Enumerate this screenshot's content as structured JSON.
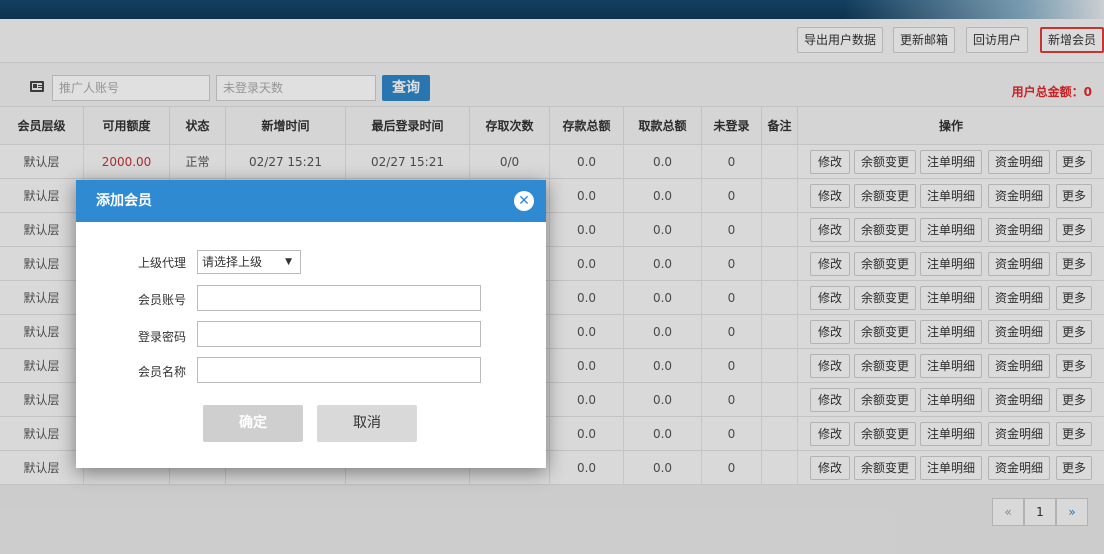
{
  "toolbar": {
    "export_label": "导出用户数据",
    "update_email_label": "更新邮箱",
    "revisit_label": "回访用户",
    "add_member_label": "新增会员"
  },
  "filter": {
    "promoter_placeholder": "推广人账号",
    "days_placeholder": "未登录天数",
    "query_label": "查询",
    "total_label": "用户总金额：0"
  },
  "table": {
    "headers": [
      "会员层级",
      "可用额度",
      "状态",
      "新增时间",
      "最后登录时间",
      "存取次数",
      "存款总额",
      "取款总额",
      "未登录",
      "备注",
      "操作"
    ],
    "first_row": {
      "level": "默认层",
      "credit": "2000.00",
      "status": "正常",
      "created": "02/27 15:21",
      "last_login": "02/27 15:21",
      "count": "0/0",
      "deposit": "0.0",
      "withdraw": "0.0",
      "not_logged": "0"
    },
    "row_level": "默认层",
    "row_deposit": "0.0",
    "row_withdraw": "0.0",
    "row_not_logged": "0",
    "actions": [
      "修改",
      "余额变更",
      "注单明细",
      "资金明细",
      "更多"
    ]
  },
  "pagination": {
    "prev": "«",
    "page": "1",
    "next": "»"
  },
  "modal": {
    "title": "添加会员",
    "close_icon": "close-icon",
    "parent_label": "上级代理",
    "parent_select": "请选择上级",
    "account_label": "会员账号",
    "password_label": "登录密码",
    "name_label": "会员名称",
    "confirm_label": "确定",
    "cancel_label": "取消"
  },
  "colors": {
    "accent": "#2f8ad2",
    "danger": "#e4262a"
  }
}
